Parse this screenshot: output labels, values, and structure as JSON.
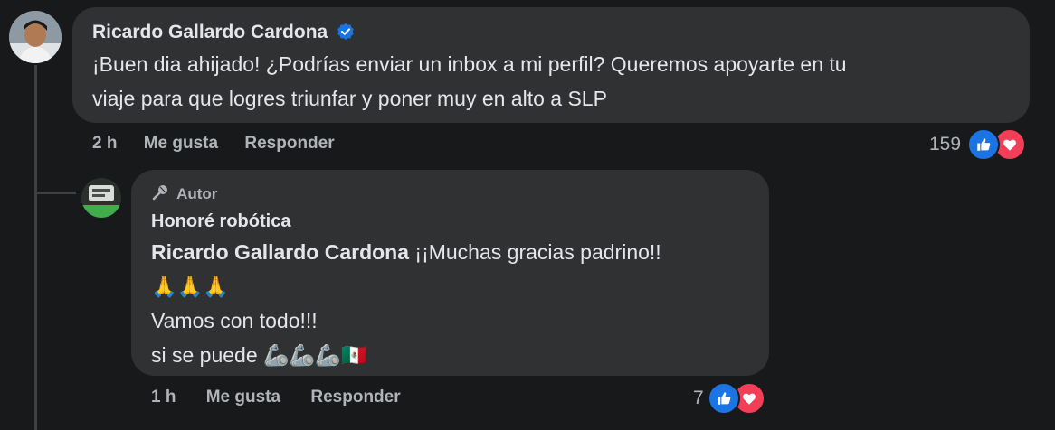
{
  "comment": {
    "author": "Ricardo Gallardo Cardona",
    "verified": true,
    "lines": [
      "¡Buen dia ahijado! ¿Podrías enviar un inbox a mi perfil? Queremos apoyarte en tu",
      "viaje para que logres triunfar y poner muy en alto a SLP"
    ],
    "time": "2 h",
    "like_label": "Me gusta",
    "reply_label": "Responder",
    "reaction_count": "159"
  },
  "reply": {
    "author_badge": "Autor",
    "author": "Honoré robótica",
    "mention": "Ricardo Gallardo Cardona",
    "text_after_mention": " ¡¡Muchas gracias padrino!!",
    "emoji_line": "🙏🙏🙏",
    "line3": "Vamos con todo!!!",
    "line4": "si se puede 🦾🦾🦾🇲🇽",
    "time": "1 h",
    "like_label": "Me gusta",
    "reply_label": "Responder",
    "reaction_count": "7"
  },
  "colors": {
    "background": "#18191a",
    "bubble": "#303132",
    "like": "#1b74e4",
    "love": "#f33e58",
    "verified": "#1b74e4"
  }
}
